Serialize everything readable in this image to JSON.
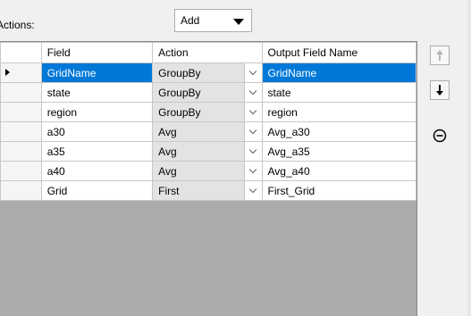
{
  "actions_label": "Actions:",
  "add_dropdown": {
    "selected": "Add"
  },
  "grid": {
    "columns": [
      "Field",
      "Action",
      "Output Field Name"
    ],
    "rows": [
      {
        "field": "GridName",
        "action": "GroupBy",
        "output": "GridName",
        "selected": true
      },
      {
        "field": "state",
        "action": "GroupBy",
        "output": "state",
        "selected": false
      },
      {
        "field": "region",
        "action": "GroupBy",
        "output": "region",
        "selected": false
      },
      {
        "field": "a30",
        "action": "Avg",
        "output": "Avg_a30",
        "selected": false
      },
      {
        "field": "a35",
        "action": "Avg",
        "output": "Avg_a35",
        "selected": false
      },
      {
        "field": "a40",
        "action": "Avg",
        "output": "Avg_a40",
        "selected": false
      },
      {
        "field": "Grid",
        "action": "First",
        "output": "First_Grid",
        "selected": false
      }
    ]
  },
  "side_buttons": [
    {
      "icon": "move-up-icon",
      "enabled": false
    },
    {
      "icon": "move-down-icon",
      "enabled": true
    },
    {
      "icon": "remove-icon",
      "enabled": true
    }
  ],
  "colors": {
    "selection": "#0078d7",
    "grid_empty": "#ababab",
    "action_cell": "#e3e3e3"
  }
}
